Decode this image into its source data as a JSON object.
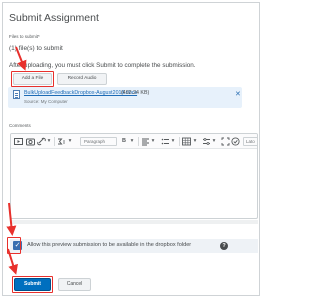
{
  "dialog": {
    "title": "Submit Assignment",
    "files_label": "Files to submit*",
    "files_count": "(1) file(s) to submit",
    "after_upload_prefix": "After",
    "after_upload_text": " uploading, you must click Submit to complete the submission."
  },
  "upload": {
    "add_file_label": "Add a File",
    "record_audio_label": "Record Audio"
  },
  "attached_file": {
    "name": "BulkUploadFeedbackDropbox-August2018.docx",
    "size": "(492.24 KB)",
    "source": "Source: My Computer"
  },
  "comments": {
    "label": "Comments",
    "paragraph_select": "Paragraph",
    "font_select": "Lato"
  },
  "preview": {
    "checkbox_checked": true,
    "label": "Allow this preview submission to be available in the dropbox folder"
  },
  "actions": {
    "submit_label": "Submit",
    "cancel_label": "Cancel"
  },
  "annotation": {
    "highlight_color": "#e8302c"
  }
}
